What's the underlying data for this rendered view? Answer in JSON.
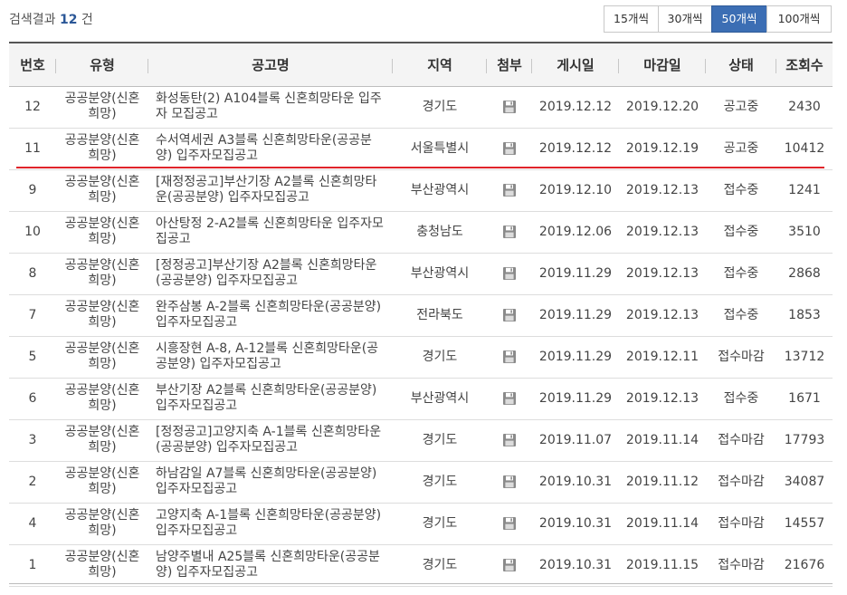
{
  "search": {
    "prefix": "검색결과",
    "count": "12",
    "suffix": "건"
  },
  "page_size": {
    "options": [
      "15개씩",
      "30개씩",
      "50개씩",
      "100개씩"
    ],
    "selected": "50개씩"
  },
  "colors": {
    "active_button": "#3c6eb4",
    "count_highlight": "#2b5797",
    "highlight_line": "#e0242a"
  },
  "table": {
    "headers": [
      "번호",
      "유형",
      "공고명",
      "지역",
      "첨부",
      "게시일",
      "마감일",
      "상태",
      "조회수"
    ],
    "attachment_icon": "floppy-disk-icon",
    "rows": [
      {
        "no": "12",
        "type": "공공분양(신혼희망)",
        "title": "화성동탄(2) A104블록 신혼희망타운 입주자 모집공고",
        "region": "경기도",
        "posted": "2019.12.12",
        "deadline": "2019.12.20",
        "status": "공고중",
        "views": "2430"
      },
      {
        "no": "11",
        "type": "공공분양(신혼희망)",
        "title": "수서역세권 A3블록 신혼희망타운(공공분양) 입주자모집공고",
        "region": "서울특별시",
        "posted": "2019.12.12",
        "deadline": "2019.12.19",
        "status": "공고중",
        "views": "10412"
      },
      {
        "no": "9",
        "type": "공공분양(신혼희망)",
        "title": "[재정정공고]부산기장 A2블록 신혼희망타운(공공분양) 입주자모집공고",
        "region": "부산광역시",
        "posted": "2019.12.10",
        "deadline": "2019.12.13",
        "status": "접수중",
        "views": "1241"
      },
      {
        "no": "10",
        "type": "공공분양(신혼희망)",
        "title": "아산탕정 2-A2블록 신혼희망타운 입주자모집공고",
        "region": "충청남도",
        "posted": "2019.12.06",
        "deadline": "2019.12.13",
        "status": "접수중",
        "views": "3510"
      },
      {
        "no": "8",
        "type": "공공분양(신혼희망)",
        "title": "[정정공고]부산기장 A2블록 신혼희망타운(공공분양) 입주자모집공고",
        "region": "부산광역시",
        "posted": "2019.11.29",
        "deadline": "2019.12.13",
        "status": "접수중",
        "views": "2868"
      },
      {
        "no": "7",
        "type": "공공분양(신혼희망)",
        "title": "완주삼봉 A-2블록 신혼희망타운(공공분양) 입주자모집공고",
        "region": "전라북도",
        "posted": "2019.11.29",
        "deadline": "2019.12.13",
        "status": "접수중",
        "views": "1853"
      },
      {
        "no": "5",
        "type": "공공분양(신혼희망)",
        "title": "시흥장현 A-8, A-12블록 신혼희망타운(공공분양) 입주자모집공고",
        "region": "경기도",
        "posted": "2019.11.29",
        "deadline": "2019.12.11",
        "status": "접수마감",
        "views": "13712"
      },
      {
        "no": "6",
        "type": "공공분양(신혼희망)",
        "title": "부산기장 A2블록 신혼희망타운(공공분양) 입주자모집공고",
        "region": "부산광역시",
        "posted": "2019.11.29",
        "deadline": "2019.12.13",
        "status": "접수중",
        "views": "1671"
      },
      {
        "no": "3",
        "type": "공공분양(신혼희망)",
        "title": "[정정공고]고양지축 A-1블록 신혼희망타운(공공분양) 입주자모집공고",
        "region": "경기도",
        "posted": "2019.11.07",
        "deadline": "2019.11.14",
        "status": "접수마감",
        "views": "17793"
      },
      {
        "no": "2",
        "type": "공공분양(신혼희망)",
        "title": "하남감일 A7블록 신혼희망타운(공공분양) 입주자모집공고",
        "region": "경기도",
        "posted": "2019.10.31",
        "deadline": "2019.11.12",
        "status": "접수마감",
        "views": "34087"
      },
      {
        "no": "4",
        "type": "공공분양(신혼희망)",
        "title": "고양지축 A-1블록 신혼희망타운(공공분양) 입주자모집공고",
        "region": "경기도",
        "posted": "2019.10.31",
        "deadline": "2019.11.14",
        "status": "접수마감",
        "views": "14557"
      },
      {
        "no": "1",
        "type": "공공분양(신혼희망)",
        "title": "남양주별내 A25블록 신혼희망타운(공공분양) 입주자모집공고",
        "region": "경기도",
        "posted": "2019.10.31",
        "deadline": "2019.11.15",
        "status": "접수마감",
        "views": "21676"
      }
    ]
  }
}
